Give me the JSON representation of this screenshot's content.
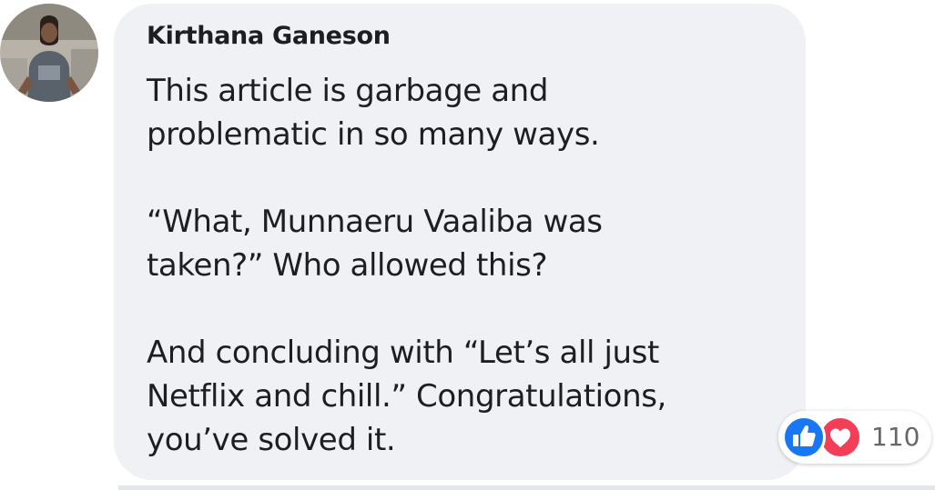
{
  "comment": {
    "author": "Kirthana Ganeson",
    "paragraphs": [
      "This article is garbage and\nproblematic in so many ways.",
      "“What, Munnaeru Vaaliba was\ntaken?” Who allowed this?",
      "And concluding with “Let’s all just\nNetflix and chill.” Congratulations,\nyou’ve solved it."
    ]
  },
  "reactions": {
    "icons": [
      "like-icon",
      "love-icon"
    ],
    "count": "110",
    "colors": {
      "like": "#1877f2",
      "love": "#f33e58"
    }
  },
  "colors": {
    "bubble": "#f0f1f4",
    "text": "#1c1e21",
    "muted": "#65676b"
  }
}
